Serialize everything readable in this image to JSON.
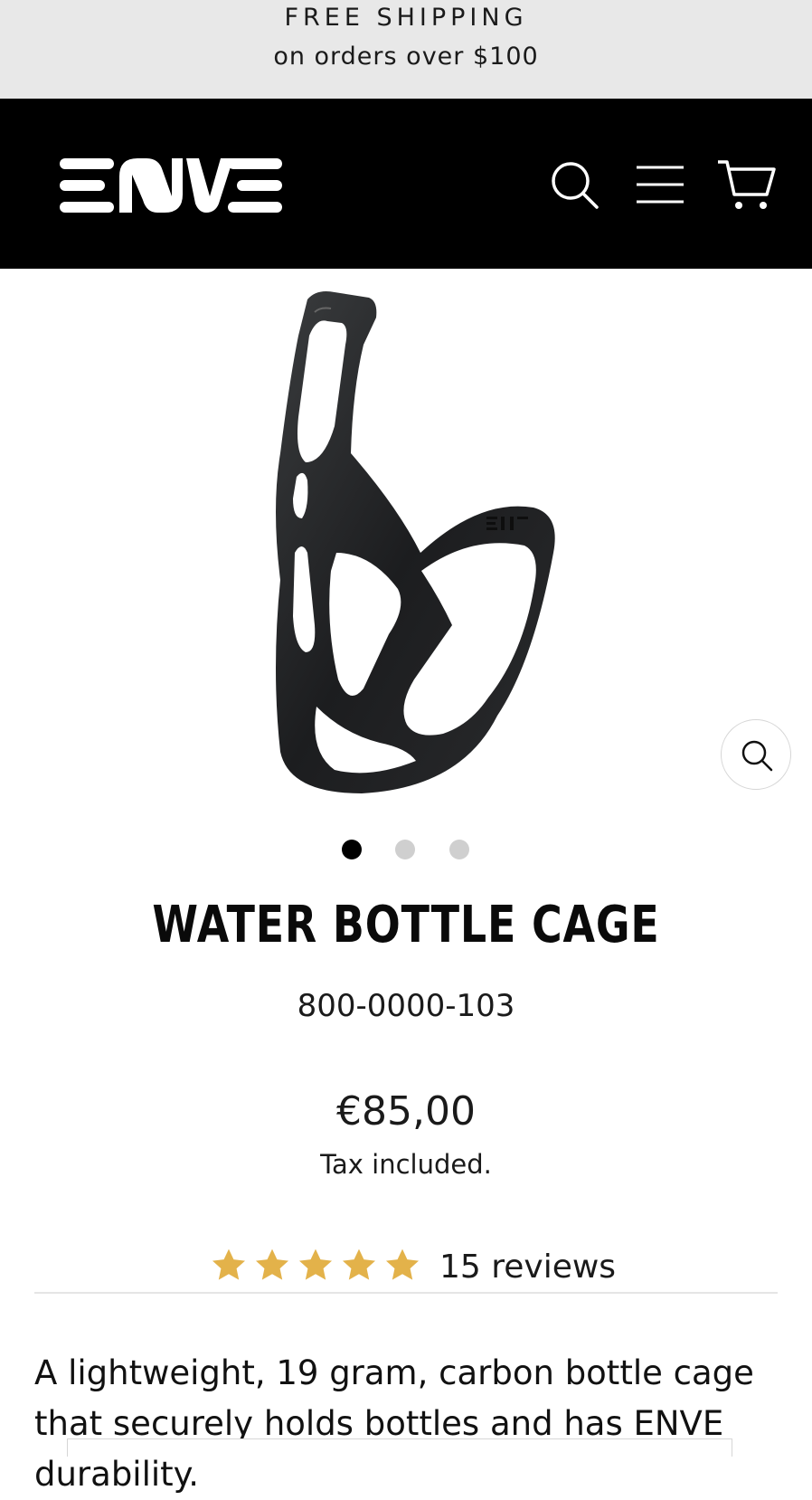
{
  "announcement": {
    "headline": "FREE SHIPPING",
    "subline": "on orders over $100"
  },
  "header": {
    "logo_text": "ENVE",
    "icons": [
      "search-icon",
      "menu-icon",
      "cart-icon"
    ],
    "background": "#000000",
    "foreground": "#ffffff"
  },
  "gallery": {
    "image_alt": "carbon water bottle cage",
    "slides": 3,
    "active_slide": 1,
    "zoom_icon": "zoom-icon"
  },
  "product": {
    "title": "WATER BOTTLE CAGE",
    "sku": "800-0000-103",
    "price": "€85,00",
    "tax_note": "Tax included.",
    "rating": {
      "stars": 5,
      "max_stars": 5,
      "star_color": "#e3b24a",
      "reviews_label": "15 reviews"
    },
    "description": "A lightweight, 19 gram, carbon bottle cage that securely holds bottles and has ENVE durability."
  }
}
